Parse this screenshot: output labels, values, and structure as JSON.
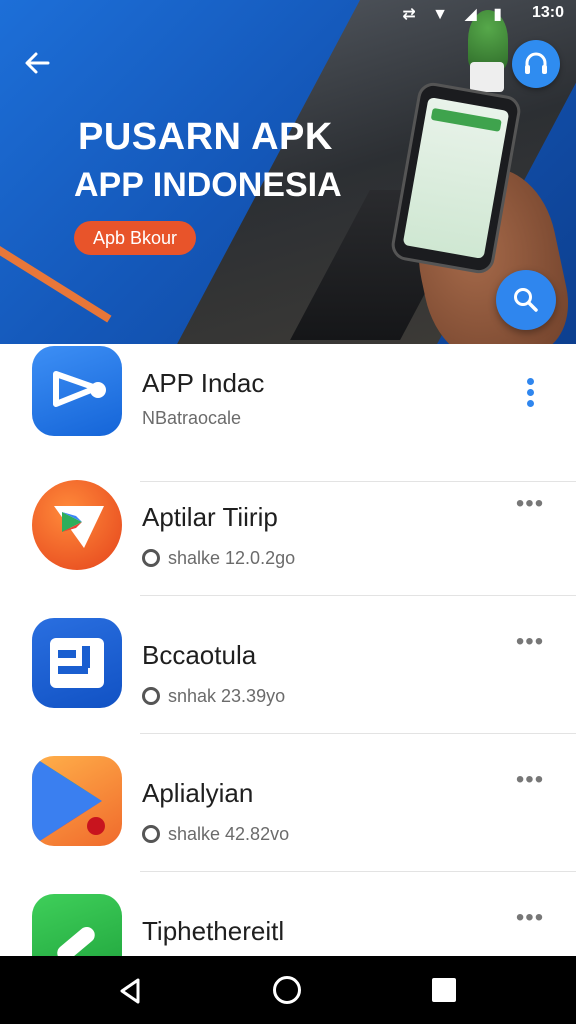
{
  "status_bar": {
    "icons": "⇄ ▼ ◢ ▮",
    "time": "13:0"
  },
  "header": {
    "back_icon": "arrow-left-icon",
    "title": "PUSARN APK",
    "subtitle": "APP INDONESIA",
    "pill_label": "Apb Bkour",
    "headset_icon": "headset-icon",
    "search_icon": "search-icon",
    "accent_color": "#e8542a",
    "brand_color": "#1d6fd8"
  },
  "apps": [
    {
      "name": "APP Indac",
      "meta": "NBatraocale",
      "menu": "vertical"
    },
    {
      "name": "Aptilar Tiirip",
      "meta": "shalke 12.0.2go",
      "menu": "horizontal"
    },
    {
      "name": "Bccaotula",
      "meta": "snhak 23.39yo",
      "menu": "horizontal"
    },
    {
      "name": "Aplialyian",
      "meta": "shalke 42.82vo",
      "menu": "horizontal"
    },
    {
      "name": "Tiphethereitl",
      "meta": "",
      "menu": "horizontal"
    }
  ],
  "nav": {
    "back": "back-triangle-icon",
    "home": "home-circle-icon",
    "recent": "recent-square-icon"
  }
}
